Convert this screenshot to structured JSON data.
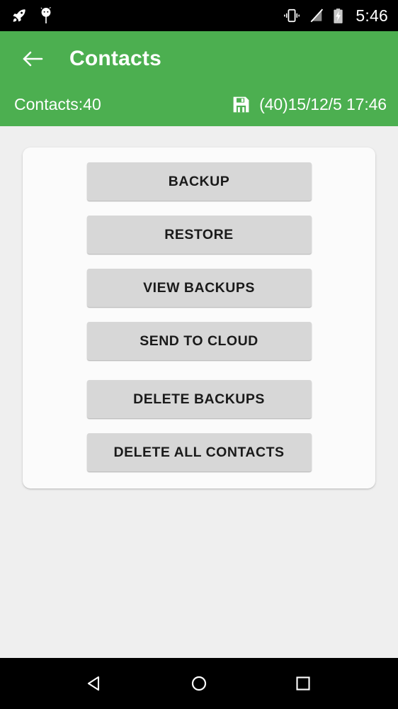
{
  "status_bar": {
    "left_icons": [
      {
        "name": "rocket-icon"
      },
      {
        "name": "android-head-pin-icon"
      }
    ],
    "right_icons": [
      {
        "name": "vibrate-icon"
      },
      {
        "name": "signal-off-icon"
      },
      {
        "name": "battery-charging-icon"
      }
    ],
    "time": "5:46",
    "background_color": "#000000"
  },
  "appbar": {
    "back_icon": "arrow-back-icon",
    "title": "Contacts",
    "background_color": "#4CAF50",
    "text_color": "#FFFFFF"
  },
  "subtitle": {
    "contacts_label": "Contacts:40",
    "save_icon": "floppy-disk-save-icon",
    "last_backup": "(40)15/12/5 17:46"
  },
  "card": {
    "background_color": "#FBFBFB",
    "button_color": "#D7D7D7",
    "groups": [
      {
        "name": "primary-actions",
        "buttons": [
          {
            "id": "backup",
            "label": "BACKUP"
          },
          {
            "id": "restore",
            "label": "RESTORE"
          },
          {
            "id": "view-backups",
            "label": "VIEW BACKUPS"
          },
          {
            "id": "send-to-cloud",
            "label": "SEND TO CLOUD"
          }
        ]
      },
      {
        "name": "destructive-actions",
        "buttons": [
          {
            "id": "delete-backups",
            "label": "DELETE BACKUPS"
          },
          {
            "id": "delete-all-contacts",
            "label": "DELETE ALL CONTACTS"
          }
        ]
      }
    ]
  },
  "navbar": {
    "buttons": [
      {
        "name": "nav-back-icon"
      },
      {
        "name": "nav-home-icon"
      },
      {
        "name": "nav-recents-icon"
      }
    ],
    "background_color": "#000000"
  },
  "page_background_color": "#EFEFEF"
}
